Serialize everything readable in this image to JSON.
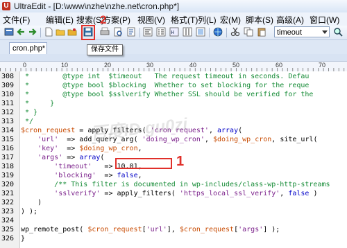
{
  "window": {
    "title": "UltraEdit - [D:\\www\\nzhe\\nzhe.net\\cron.php*]"
  },
  "menu": [
    "文件(F)",
    "编辑(E)",
    "搜索(S)",
    "方案(P)",
    "视图(V)",
    "格式(T)",
    "列(L)",
    "宏(M)",
    "脚本(S)",
    "高级(A)",
    "窗口(W)"
  ],
  "toolbar": {
    "search_value": "timeout"
  },
  "tabs": [
    {
      "label": "cron.php*"
    }
  ],
  "tooltip": "保存文件",
  "ruler": [
    "0",
    "10",
    "20",
    "30",
    "40",
    "50",
    "60",
    "70"
  ],
  "watermark": "百度ID gu0zi",
  "annotations": {
    "one": "1",
    "two": "2"
  },
  "code_lines": [
    {
      "num": "308",
      "text": " *        @type int  $timeout   The request timeout in seconds. Defau"
    },
    {
      "num": "309",
      "text": " *        @type bool $blocking  Whether to set blocking for the reque"
    },
    {
      "num": "310",
      "text": " *        @type bool $sslverify Whether SSL should be verified for the"
    },
    {
      "num": "311",
      "text": " *     }"
    },
    {
      "num": "312",
      "text": " * }"
    },
    {
      "num": "313",
      "text": " */"
    },
    {
      "num": "314",
      "text": "$cron_request = apply_filters( 'cron_request', array("
    },
    {
      "num": "315",
      "text": "    'url'  => add_query_arg( 'doing_wp_cron', $doing_wp_cron, site_url("
    },
    {
      "num": "316",
      "text": "    'key'  => $doing_wp_cron,"
    },
    {
      "num": "317",
      "text": "    'args' => array("
    },
    {
      "num": "318",
      "text": "        'timeout'   => 10.01,"
    },
    {
      "num": "319",
      "text": "        'blocking'  => false,"
    },
    {
      "num": "320",
      "text": "        /** This filter is documented in wp-includes/class-wp-http-streams"
    },
    {
      "num": "321",
      "text": "        'sslverify' => apply_filters( 'https_local_ssl_verify', false )"
    },
    {
      "num": "322",
      "text": "    )"
    },
    {
      "num": "323",
      "text": ") );"
    },
    {
      "num": "324",
      "text": ""
    },
    {
      "num": "325",
      "text": "wp_remote_post( $cron_request['url'], $cron_request['args'] );"
    },
    {
      "num": "326",
      "text": "}"
    }
  ],
  "colors": {
    "comment": "#138a34",
    "variable": "#c84a00",
    "string": "#7a1f8a",
    "keyword": "#0000c8",
    "annotation": "#e0302a"
  }
}
